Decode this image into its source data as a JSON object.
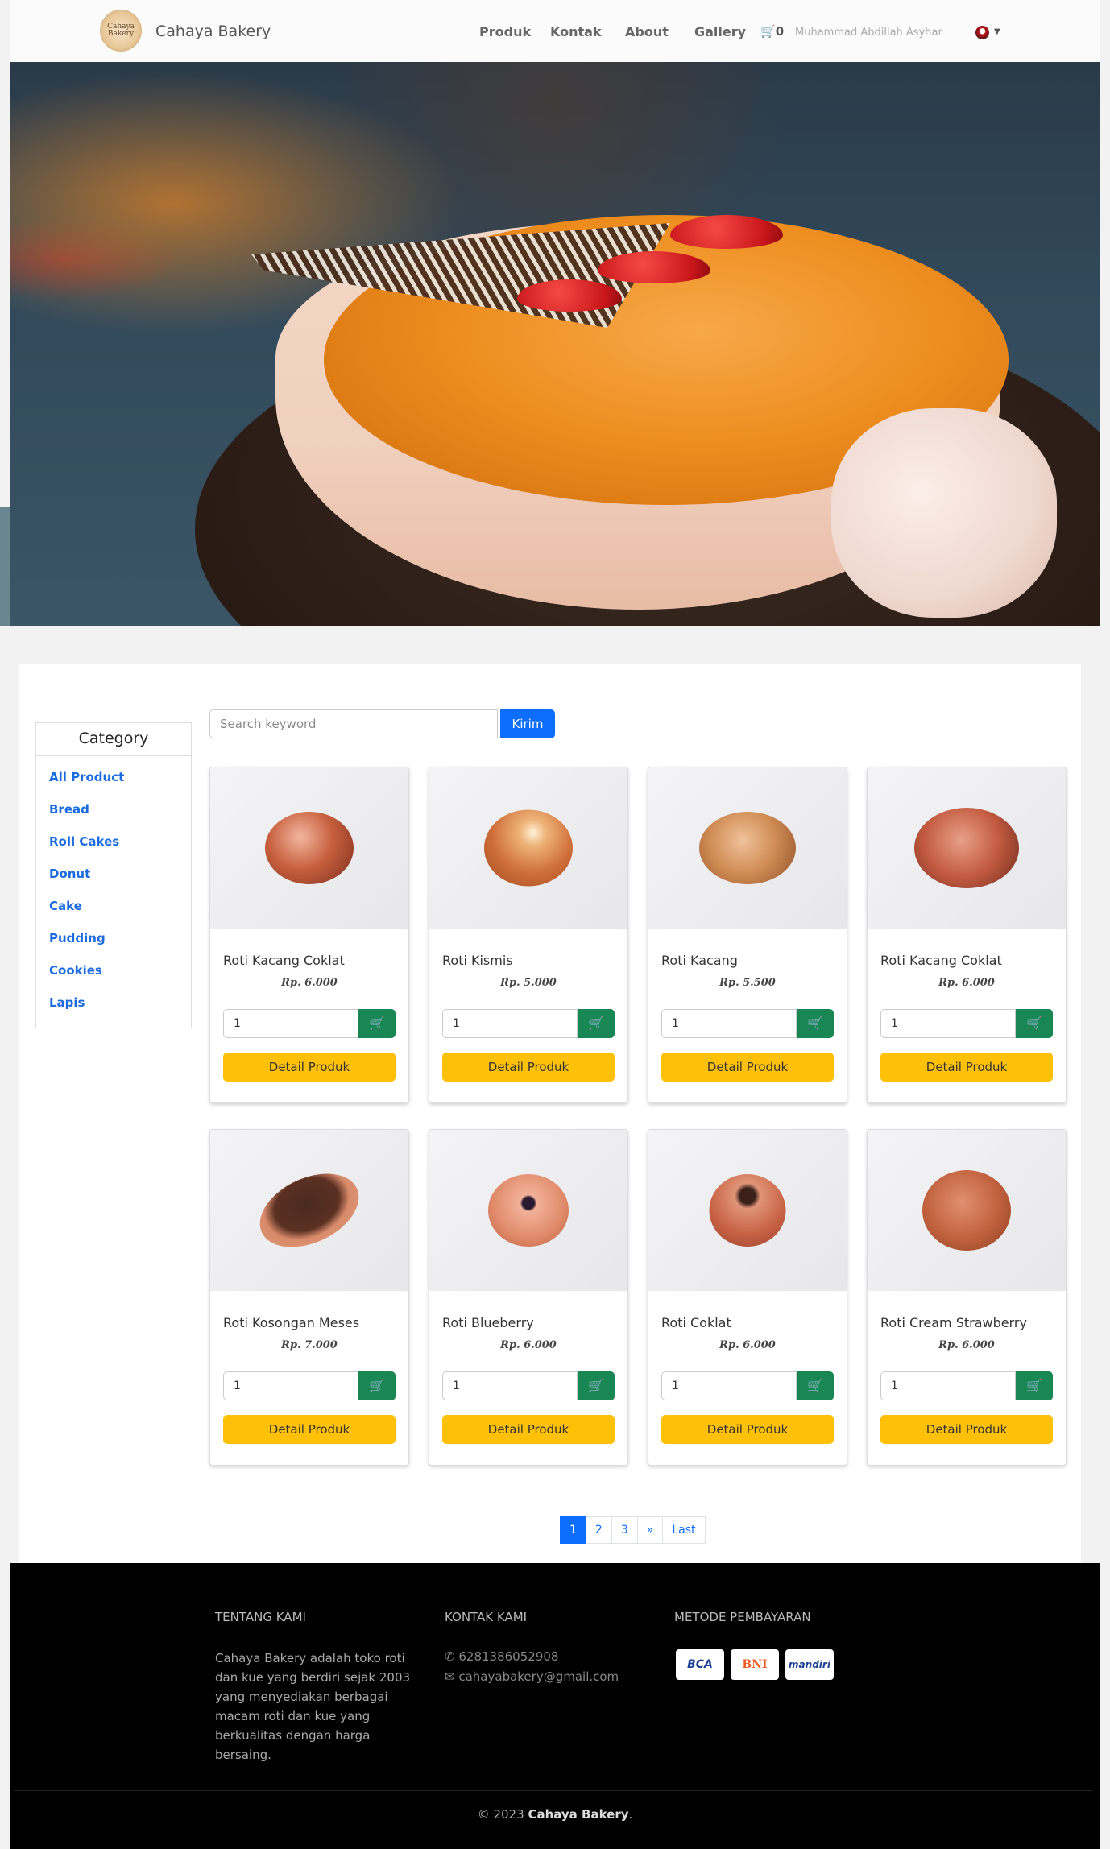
{
  "brand": {
    "name": "Cahaya Bakery",
    "logo_text": "Cahaya Bakery"
  },
  "nav": {
    "items": [
      "Produk",
      "Kontak",
      "About",
      "Gallery"
    ],
    "cart_count": "0",
    "user_name": "Muhammad Abdillah Asyhar"
  },
  "sidebar": {
    "title": "Category",
    "items": [
      "All Product",
      "Bread",
      "Roll Cakes",
      "Donut",
      "Cake",
      "Pudding",
      "Cookies",
      "Lapis"
    ]
  },
  "search": {
    "placeholder": "Search keyword",
    "button": "Kirim"
  },
  "products": [
    {
      "name": "Roti Kacang Coklat",
      "price": "Rp. 6.000",
      "qty": "1",
      "detail": "Detail Produk"
    },
    {
      "name": "Roti Kismis",
      "price": "Rp. 5.000",
      "qty": "1",
      "detail": "Detail Produk"
    },
    {
      "name": "Roti Kacang",
      "price": "Rp. 5.500",
      "qty": "1",
      "detail": "Detail Produk"
    },
    {
      "name": "Roti Kacang Coklat",
      "price": "Rp. 6.000",
      "qty": "1",
      "detail": "Detail Produk"
    },
    {
      "name": "Roti Kosongan Meses",
      "price": "Rp. 7.000",
      "qty": "1",
      "detail": "Detail Produk"
    },
    {
      "name": "Roti Blueberry",
      "price": "Rp. 6.000",
      "qty": "1",
      "detail": "Detail Produk"
    },
    {
      "name": "Roti Coklat",
      "price": "Rp. 6.000",
      "qty": "1",
      "detail": "Detail Produk"
    },
    {
      "name": "Roti Cream Strawberry",
      "price": "Rp. 6.000",
      "qty": "1",
      "detail": "Detail Produk"
    }
  ],
  "pagination": [
    "1",
    "2",
    "3",
    "»",
    "Last"
  ],
  "footer": {
    "about_heading": "TENTANG KAMI",
    "about_text": "Cahaya Bakery adalah toko roti dan kue yang berdiri sejak 2003 yang menyediakan berbagai macam roti dan kue yang berkualitas dengan harga bersaing.",
    "contact_heading": "KONTAK KAMI",
    "phone": "6281386052908",
    "email": "cahayabakery@gmail.com",
    "payment_heading": "METODE PEMBAYARAN",
    "payments": [
      "BCA",
      "BNI",
      "mandiri"
    ],
    "copyright_prefix": "© 2023",
    "copyright_brand": "Cahaya Bakery",
    "copyright_suffix": "."
  },
  "colors": {
    "primary": "#0d6efd",
    "success": "#198754",
    "warning": "#ffc107",
    "footer_bg": "#000000"
  },
  "icons": [
    "cart-icon",
    "whatsapp-icon",
    "envelope-icon",
    "add-to-cart-icon",
    "caret-down-icon"
  ]
}
